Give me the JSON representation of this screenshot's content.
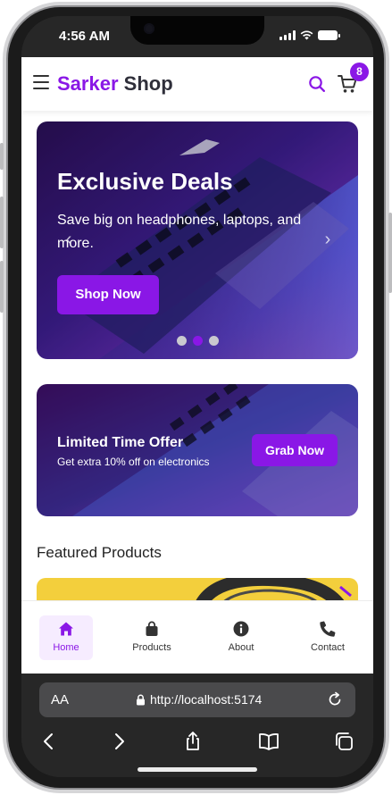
{
  "status_bar": {
    "time": "4:56 AM"
  },
  "header": {
    "brand_primary": "Sarker",
    "brand_secondary": "Shop",
    "cart_count": "8"
  },
  "hero": {
    "title": "Exclusive Deals",
    "subtitle": "Save big on headphones, laptops, and more.",
    "button_label": "Shop Now",
    "slide_count": 3,
    "active_slide": 2
  },
  "promo": {
    "title": "Limited Time Offer",
    "subtitle": "Get extra 10% off on electronics",
    "button_label": "Grab Now"
  },
  "featured": {
    "title": "Featured Products"
  },
  "bottom_nav": {
    "items": [
      {
        "label": "Home",
        "icon": "home-icon",
        "active": true
      },
      {
        "label": "Products",
        "icon": "shopping-bag-icon",
        "active": false
      },
      {
        "label": "About",
        "icon": "info-icon",
        "active": false
      },
      {
        "label": "Contact",
        "icon": "phone-icon",
        "active": false
      }
    ]
  },
  "browser": {
    "text_size_label": "AA",
    "url": "http://localhost:5174"
  },
  "colors": {
    "accent": "#8a17e6",
    "active_nav_bg": "#f6ecff",
    "browser_chrome": "#272727"
  }
}
